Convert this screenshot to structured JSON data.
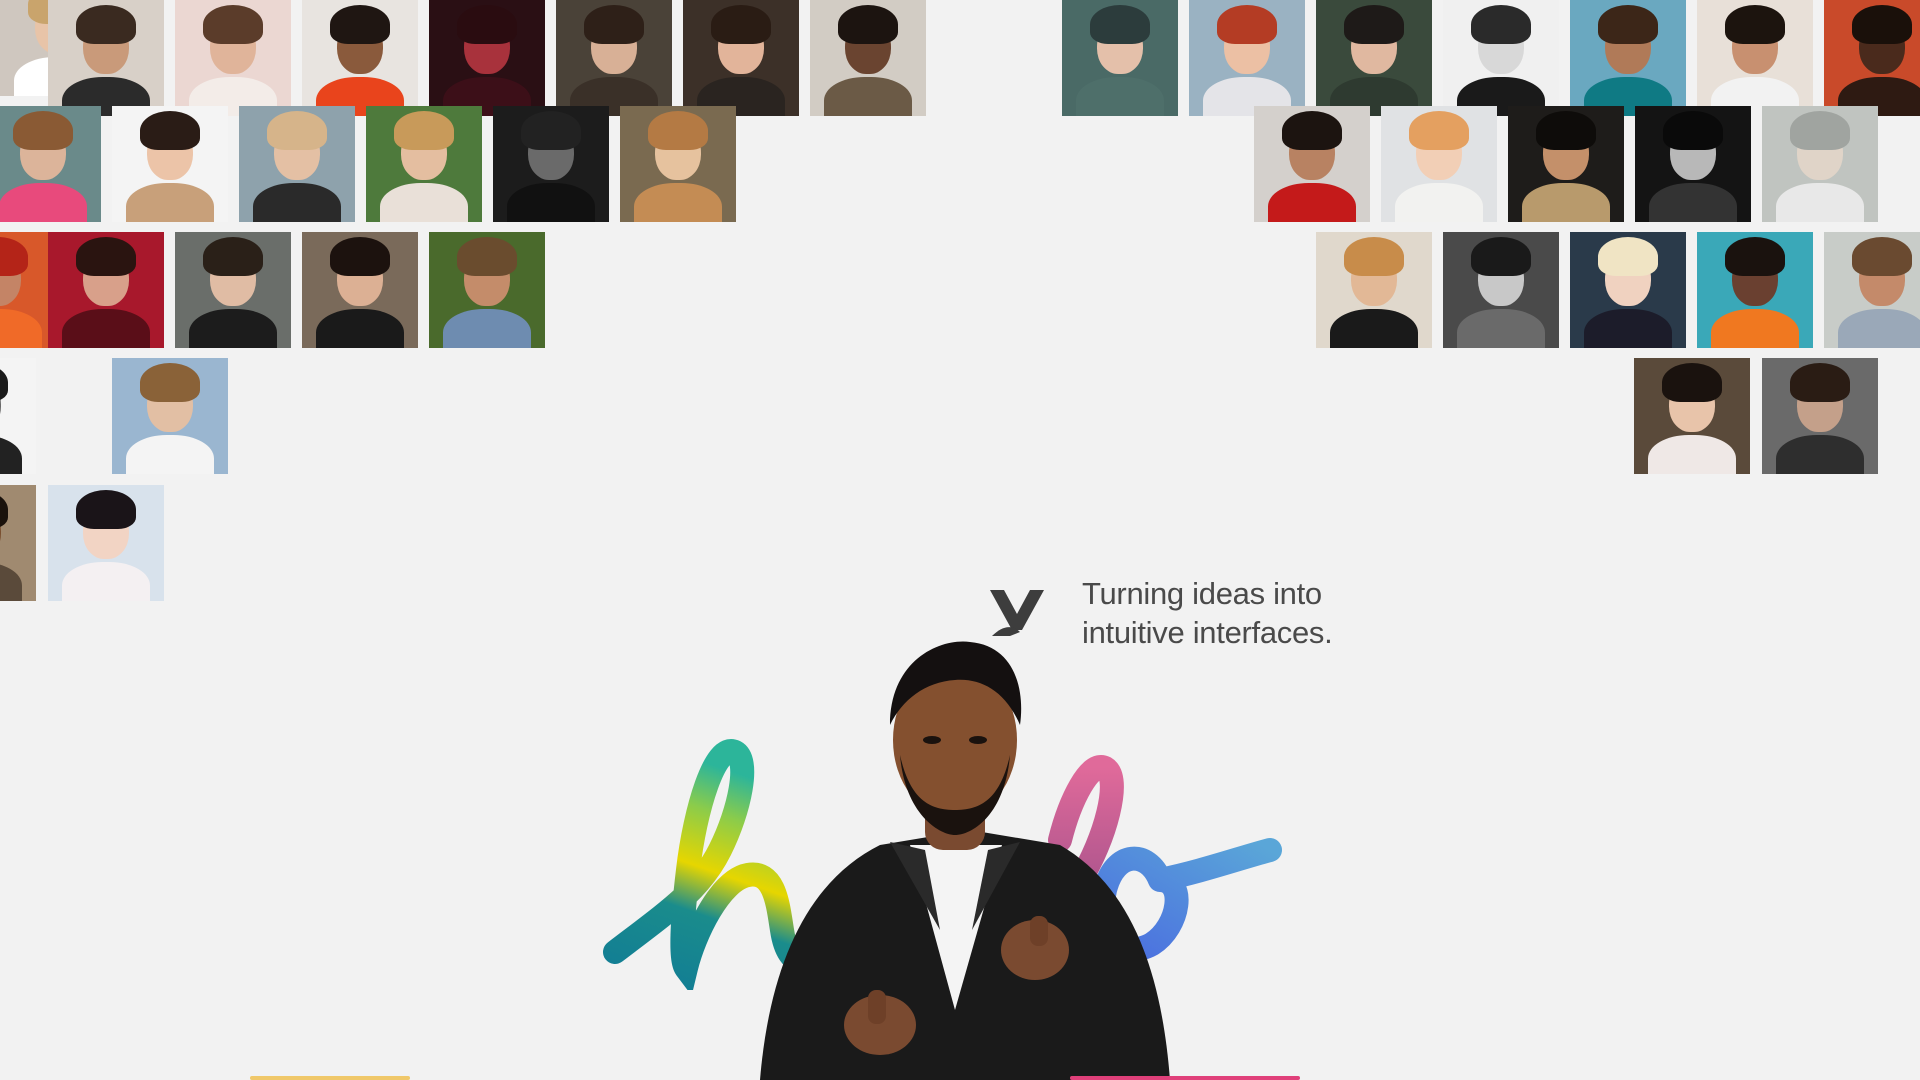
{
  "tagline": {
    "line1": "Turning ideas into",
    "line2": "intuitive interfaces."
  },
  "logo": {
    "icon": "v-monogram-icon",
    "color": "#3d3d3d"
  },
  "hello_lettering": {
    "icon": "hello-script-icon",
    "colors": [
      "#127e94",
      "#e8d800",
      "#2cb59a",
      "#d4659a",
      "#4a86e0"
    ]
  },
  "portrait": {
    "icon": "man-in-black-suit-photo"
  },
  "palette": {
    "background": "#f2f2f2",
    "text": "#4a4a4a"
  },
  "photos": [
    {
      "bg": "#cfc7bf",
      "skin": "#e8c4a8",
      "hair": "#c9a46c",
      "shirt": "#ffffff",
      "gray": false
    },
    {
      "bg": "#d8d0c8",
      "skin": "#c99a7a",
      "hair": "#3a2a20",
      "shirt": "#2b2b2b",
      "gray": false
    },
    {
      "bg": "#ebd7d2",
      "skin": "#e0b49a",
      "hair": "#5b3c2a",
      "shirt": "#f3ece8",
      "gray": false
    },
    {
      "bg": "#e8e4e0",
      "skin": "#8a5a3c",
      "hair": "#1f1612",
      "shirt": "#e9441c",
      "gray": false
    },
    {
      "bg": "#2a0f14",
      "skin": "#a8323c",
      "hair": "#2a0c10",
      "shirt": "#3c0f18",
      "gray": false
    },
    {
      "bg": "#4a4238",
      "skin": "#d8b096",
      "hair": "#2e2018",
      "shirt": "#3a3028",
      "gray": false
    },
    {
      "bg": "#3c3028",
      "skin": "#e2b49a",
      "hair": "#2a1c14",
      "shirt": "#2a2420",
      "gray": false
    },
    {
      "bg": "#d2ccc4",
      "skin": "#6a4430",
      "hair": "#1c1410",
      "shirt": "#6b5a46",
      "gray": false
    },
    {
      "bg": "#4a6a66",
      "skin": "#e4c0aa",
      "hair": "#2c3c3c",
      "shirt": "#4e6f6a",
      "gray": false
    },
    {
      "bg": "#9ab2c2",
      "skin": "#ecc0a4",
      "hair": "#b43c24",
      "shirt": "#e4e4e8",
      "gray": false
    },
    {
      "bg": "#3a4a3c",
      "skin": "#e0b8a0",
      "hair": "#1e1a18",
      "shirt": "#2e3a30",
      "gray": false
    },
    {
      "bg": "#f0f0f0",
      "skin": "#d8d8d8",
      "hair": "#2a2a2a",
      "shirt": "#1a1a1a",
      "gray": true
    },
    {
      "bg": "#6aa8c0",
      "skin": "#b07a58",
      "hair": "#3c2618",
      "shirt": "#0f7a84",
      "gray": false
    },
    {
      "bg": "#e8e0d8",
      "skin": "#c89070",
      "hair": "#1c140e",
      "shirt": "#f2f2f2",
      "gray": false
    },
    {
      "bg": "#c94a2a",
      "skin": "#4a2a1c",
      "hair": "#1a100a",
      "shirt": "#2e1a12",
      "gray": false
    },
    {
      "bg": "#6a8a8a",
      "skin": "#dcb49a",
      "hair": "#8a5a34",
      "shirt": "#e84a7c",
      "gray": false
    },
    {
      "bg": "#f4f4f4",
      "skin": "#ecc4a8",
      "hair": "#2a1c16",
      "shirt": "#c8a07a",
      "gray": false
    },
    {
      "bg": "#8ea2ac",
      "skin": "#e4c0a4",
      "hair": "#d6b48a",
      "shirt": "#2a2a2a",
      "gray": false
    },
    {
      "bg": "#4e7a3c",
      "skin": "#e4bea0",
      "hair": "#c89a5a",
      "shirt": "#e9e0d8",
      "gray": false
    },
    {
      "bg": "#1c1c1c",
      "skin": "#6a6a6a",
      "hair": "#222222",
      "shirt": "#111111",
      "gray": true
    },
    {
      "bg": "#7a6a50",
      "skin": "#e6c29e",
      "hair": "#b47a44",
      "shirt": "#c48c54",
      "gray": false
    },
    {
      "bg": "#d4d0cc",
      "skin": "#b88262",
      "hair": "#1c1410",
      "shirt": "#c41a1a",
      "gray": false
    },
    {
      "bg": "#e0e2e4",
      "skin": "#f2cfb6",
      "hair": "#e4a060",
      "shirt": "#f2f2f0",
      "gray": false
    },
    {
      "bg": "#1e1c1a",
      "skin": "#c4906a",
      "hair": "#0e0c0a",
      "shirt": "#b89a6c",
      "gray": false
    },
    {
      "bg": "#141414",
      "skin": "#b8b8b8",
      "hair": "#0a0a0a",
      "shirt": "#333333",
      "gray": true
    },
    {
      "bg": "#c0c4c0",
      "skin": "#e0d4c8",
      "hair": "#a0a4a0",
      "shirt": "#e8e8e8",
      "gray": false
    },
    {
      "bg": "#d8582a",
      "skin": "#c48466",
      "hair": "#b42418",
      "shirt": "#f06a28",
      "gray": false
    },
    {
      "bg": "#a8182c",
      "skin": "#d8a08a",
      "hair": "#2a1410",
      "shirt": "#5a0e18",
      "gray": false
    },
    {
      "bg": "#6a6e6a",
      "skin": "#e0bca4",
      "hair": "#2a2018",
      "shirt": "#1c1c1c",
      "gray": false
    },
    {
      "bg": "#7a6a5a",
      "skin": "#dcb094",
      "hair": "#1c120e",
      "shirt": "#1a1a1a",
      "gray": false
    },
    {
      "bg": "#4a6a2c",
      "skin": "#c48c6a",
      "hair": "#6a4c2e",
      "shirt": "#6e8cb0",
      "gray": false
    },
    {
      "bg": "#e0d8cc",
      "skin": "#e2b896",
      "hair": "#c88c4a",
      "shirt": "#1a1a1a",
      "gray": false
    },
    {
      "bg": "#4a4a4a",
      "skin": "#c8c8c8",
      "hair": "#1a1a1a",
      "shirt": "#6a6a6a",
      "gray": true
    },
    {
      "bg": "#2a3a4a",
      "skin": "#f0d2c0",
      "hair": "#f0e4c4",
      "shirt": "#1c1c2a",
      "gray": false
    },
    {
      "bg": "#3aa8b8",
      "skin": "#6a4030",
      "hair": "#1a120e",
      "shirt": "#f07820",
      "gray": false
    },
    {
      "bg": "#c8ccc8",
      "skin": "#c48a6a",
      "hair": "#6a4a30",
      "shirt": "#9aa8b8",
      "gray": false
    },
    {
      "bg": "#f4f4f4",
      "skin": "#6a6a6a",
      "hair": "#1a1a1a",
      "shirt": "#222222",
      "gray": true
    },
    {
      "bg": "#9ab6d0",
      "skin": "#e2bfa4",
      "hair": "#8a6238",
      "shirt": "#f4f4f4",
      "gray": false
    },
    {
      "bg": "#5a4a3a",
      "skin": "#e8c4aa",
      "hair": "#1a120e",
      "shirt": "#efe8e6",
      "gray": false
    },
    {
      "bg": "#6a6a6a",
      "skin": "#c4a08a",
      "hair": "#2a1c14",
      "shirt": "#2e2e2e",
      "gray": false
    },
    {
      "bg": "#a08a70",
      "skin": "#7a5030",
      "hair": "#1a120c",
      "shirt": "#5a4a3a",
      "gray": false
    },
    {
      "bg": "#d8e2ec",
      "skin": "#f2d4c4",
      "hair": "#1a1418",
      "shirt": "#f4f0f2",
      "gray": false
    }
  ]
}
